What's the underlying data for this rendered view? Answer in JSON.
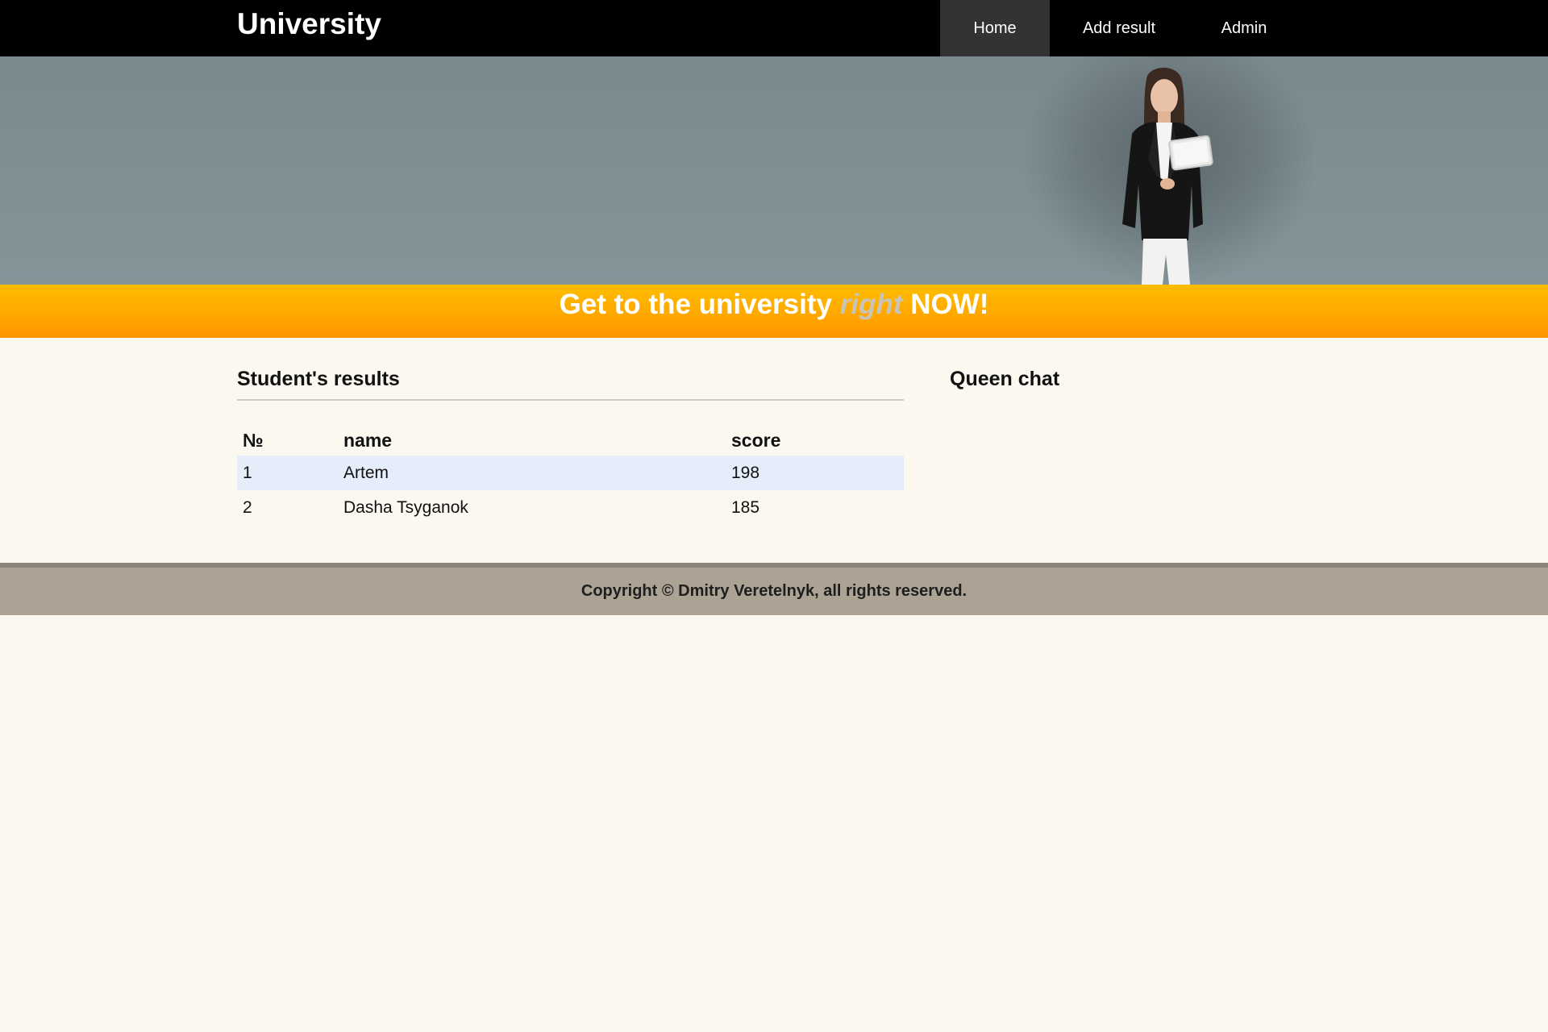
{
  "header": {
    "brand": "University",
    "nav": [
      {
        "label": "Home",
        "active": true
      },
      {
        "label": "Add result",
        "active": false
      },
      {
        "label": "Admin",
        "active": false
      }
    ]
  },
  "hero": {
    "image": "woman-with-tablet-photo"
  },
  "banner": {
    "text_before": "Get to the university",
    "text_emphasis": "right",
    "text_after": "NOW!"
  },
  "results": {
    "title": "Student's results",
    "columns": [
      "№",
      "name",
      "score"
    ],
    "rows": [
      {
        "n": "1",
        "name": "Artem",
        "score": "198"
      },
      {
        "n": "2",
        "name": "Dasha Tsyganok",
        "score": "185"
      }
    ]
  },
  "chat": {
    "title": "Queen chat"
  },
  "footer": {
    "copyright": "Copyright © Dmitry Veretelnyk, all rights reserved."
  },
  "colors": {
    "topbar": "#000000",
    "banner": "#ffa800",
    "footer": "#aca394",
    "page_bg": "#fbf8f0",
    "row_highlight": "#e5ecfa"
  }
}
